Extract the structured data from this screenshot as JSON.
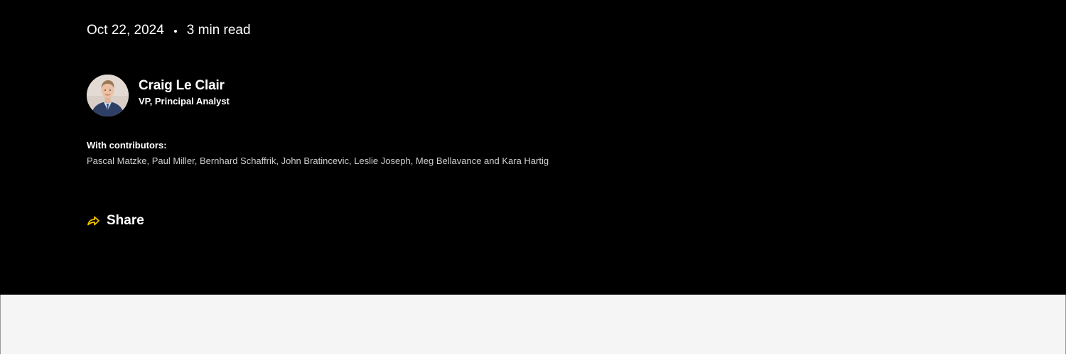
{
  "article": {
    "date": "Oct 22, 2024",
    "separator": "•",
    "read_time": "3 min read"
  },
  "author": {
    "name": "Craig Le Clair",
    "title": "VP, Principal Analyst",
    "avatar_icon": "author-photo"
  },
  "contributors": {
    "label": "With contributors:",
    "names": "Pascal Matzke, Paul Miller, Bernhard Schaffrik, John Bratincevic, Leslie Joseph, Meg Bellavance and Kara Hartig"
  },
  "share": {
    "label": "Share",
    "icon": "share-arrow-icon",
    "icon_color": "#f2c200"
  },
  "colors": {
    "hero_background": "#000000",
    "lower_background": "#f5f5f5",
    "text": "#ffffff"
  }
}
